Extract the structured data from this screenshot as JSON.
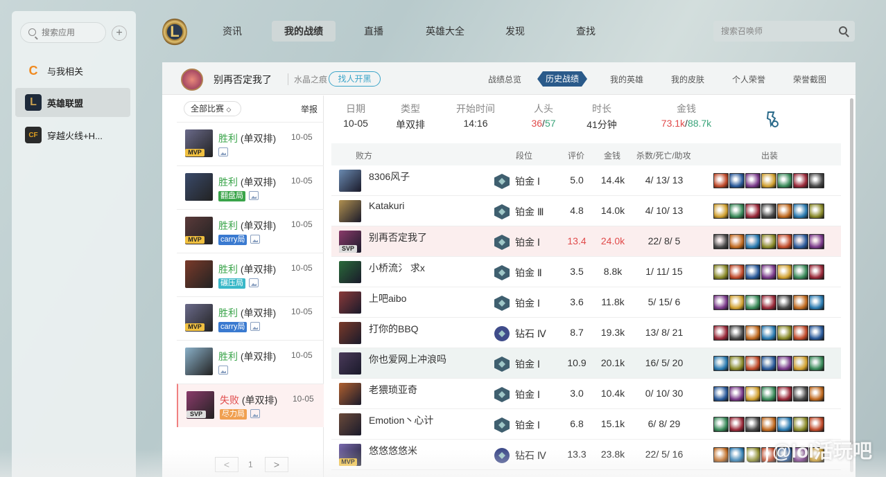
{
  "sidebar": {
    "search_placeholder": "搜索应用",
    "add_label": "+",
    "items": [
      {
        "label": "与我相关",
        "icon": "C",
        "icon_name": "related-icon",
        "color": "#f08a20"
      },
      {
        "label": "英雄联盟",
        "icon": "L",
        "icon_name": "lol-logo-icon",
        "color": "#c8a050"
      },
      {
        "label": "穿越火线+H...",
        "icon": "CF",
        "icon_name": "crossfire-logo-icon",
        "color": "#e0a020"
      }
    ]
  },
  "nav": {
    "logo": "L",
    "tabs": [
      "资讯",
      "我的战绩",
      "直播",
      "英雄大全",
      "发现",
      "查找"
    ],
    "search_placeholder": "搜索召唤师"
  },
  "profile": {
    "name": "别再否定我了",
    "server": "水晶之痕",
    "block_button": "找人开黑",
    "subtabs": [
      "战绩总览",
      "历史战绩",
      "我的英雄",
      "我的皮肤",
      "个人荣誉",
      "荣誉截图"
    ]
  },
  "games": {
    "filter": "全部比赛",
    "report": "举报",
    "list": [
      {
        "result": "胜利",
        "mode": "(单双排)",
        "date": "10-05",
        "badge": "MVP",
        "tag": "",
        "tag_color": "",
        "win": true,
        "color": "#6a6a8a"
      },
      {
        "result": "胜利",
        "mode": "(单双排)",
        "date": "10-05",
        "badge": "",
        "tag": "翻盘局",
        "tag_color": "#3aa44a",
        "win": true,
        "color": "#3a4a6a"
      },
      {
        "result": "胜利",
        "mode": "(单双排)",
        "date": "10-05",
        "badge": "MVP",
        "tag": "carry局",
        "tag_color": "#3a7ad0",
        "win": true,
        "color": "#5a3a3a"
      },
      {
        "result": "胜利",
        "mode": "(单双排)",
        "date": "10-05",
        "badge": "",
        "tag": "碾压局",
        "tag_color": "#3ab8c8",
        "win": true,
        "color": "#7a3a2a"
      },
      {
        "result": "胜利",
        "mode": "(单双排)",
        "date": "10-05",
        "badge": "MVP",
        "tag": "carry局",
        "tag_color": "#3a7ad0",
        "win": true,
        "color": "#6a6a8a"
      },
      {
        "result": "胜利",
        "mode": "(单双排)",
        "date": "10-05",
        "badge": "",
        "tag": "",
        "tag_color": "",
        "win": true,
        "color": "#8ab0c8"
      },
      {
        "result": "失败",
        "mode": "(单双排)",
        "date": "10-05",
        "badge": "SVP",
        "tag": "尽力局",
        "tag_color": "#f0a050",
        "win": false,
        "color": "#8a3a6a"
      }
    ],
    "page": "1",
    "prev": "<",
    "next": ">"
  },
  "stats": {
    "labels": [
      "日期",
      "类型",
      "开始时间",
      "人头",
      "时长",
      "金钱"
    ],
    "date": "10-05",
    "type": "单双排",
    "start": "14:16",
    "kills_a": "36",
    "kills_b": "57",
    "duration": "41分钟",
    "gold_a": "73.1k",
    "gold_b": "88.7k"
  },
  "table": {
    "headers": [
      "败方",
      "段位",
      "评价",
      "金钱",
      "杀数/死亡/助攻",
      "出装"
    ],
    "rows": [
      {
        "name": "8306风子",
        "rank": "铂金 Ⅰ",
        "tier": "plat",
        "score": "5.0",
        "gold": "14.4k",
        "kda": "4/ 13/ 13",
        "badge": "",
        "color": "#6a8ab0",
        "style": ""
      },
      {
        "name": "Katakuri",
        "rank": "铂金 Ⅲ",
        "tier": "plat",
        "score": "4.8",
        "gold": "14.0k",
        "kda": "4/ 10/ 13",
        "badge": "",
        "color": "#b09050",
        "style": ""
      },
      {
        "name": "别再否定我了",
        "rank": "铂金 Ⅰ",
        "tier": "plat",
        "score": "13.4",
        "gold": "24.0k",
        "kda": "22/ 8/ 5",
        "badge": "SVP",
        "color": "#8a3a6a",
        "style": "me"
      },
      {
        "name": "小桥流氵 求x",
        "rank": "铂金 Ⅱ",
        "tier": "plat",
        "score": "3.5",
        "gold": "8.8k",
        "kda": "1/ 11/ 15",
        "badge": "",
        "color": "#2a6a3a",
        "style": ""
      },
      {
        "name": "上吧aibo",
        "rank": "铂金 Ⅰ",
        "tier": "plat",
        "score": "3.6",
        "gold": "11.8k",
        "kda": "5/ 15/ 6",
        "badge": "",
        "color": "#8a3a3a",
        "style": ""
      },
      {
        "name": "打你的BBQ",
        "rank": "钻石 Ⅳ",
        "tier": "dia",
        "score": "8.7",
        "gold": "19.3k",
        "kda": "13/ 8/ 21",
        "badge": "",
        "color": "#7a3a2a",
        "style": ""
      },
      {
        "name": "你也爱网上冲浪吗",
        "rank": "铂金 Ⅰ",
        "tier": "plat",
        "score": "10.9",
        "gold": "20.1k",
        "kda": "16/ 5/ 20",
        "badge": "",
        "color": "#4a3a5a",
        "style": "hl"
      },
      {
        "name": "老猥琐亚奇",
        "rank": "铂金 Ⅰ",
        "tier": "plat",
        "score": "3.0",
        "gold": "10.4k",
        "kda": "0/ 10/ 30",
        "badge": "",
        "color": "#b06030",
        "style": ""
      },
      {
        "name": "Emotion丶心计",
        "rank": "铂金 Ⅰ",
        "tier": "plat",
        "score": "6.8",
        "gold": "15.1k",
        "kda": "6/ 8/ 29",
        "badge": "",
        "color": "#6a4a3a",
        "style": ""
      },
      {
        "name": "悠悠悠悠米",
        "rank": "钻石 Ⅳ",
        "tier": "dia",
        "score": "13.3",
        "gold": "23.8k",
        "kda": "22/ 5/ 16",
        "badge": "MVP",
        "color": "#7a6ab0",
        "style": ""
      }
    ],
    "item_colors": [
      "#c04a2a",
      "#2a5a9a",
      "#7a3a8a",
      "#d0a030",
      "#3a8a5a",
      "#9a2a3a",
      "#4a4a4a",
      "#c06a20",
      "#2a7ab0",
      "#8a8a2a"
    ]
  },
  "watermark": "@lol活玩吧"
}
